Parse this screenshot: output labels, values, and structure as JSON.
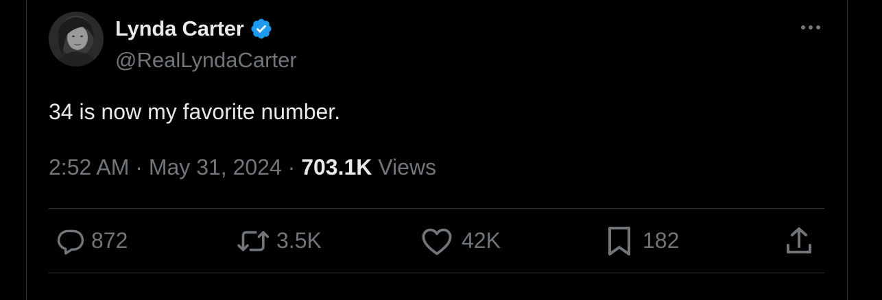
{
  "author": {
    "display_name": "Lynda Carter",
    "handle": "@RealLyndaCarter",
    "verified": true
  },
  "tweet": {
    "text": "34 is now my favorite number.",
    "time": "2:52 AM",
    "separator": "·",
    "date": "May 31, 2024",
    "views_count": "703.1K",
    "views_label": "Views"
  },
  "actions": {
    "replies": "872",
    "reposts": "3.5K",
    "likes": "42K",
    "bookmarks": "182"
  },
  "colors": {
    "background": "#000000",
    "text_primary": "#e7e9ea",
    "text_secondary": "#71767b",
    "divider": "#2f3336",
    "verified_badge": "#1d9bf0"
  },
  "icons": [
    "verified-badge-icon",
    "more-icon",
    "reply-icon",
    "repost-icon",
    "like-icon",
    "bookmark-icon",
    "share-icon"
  ]
}
